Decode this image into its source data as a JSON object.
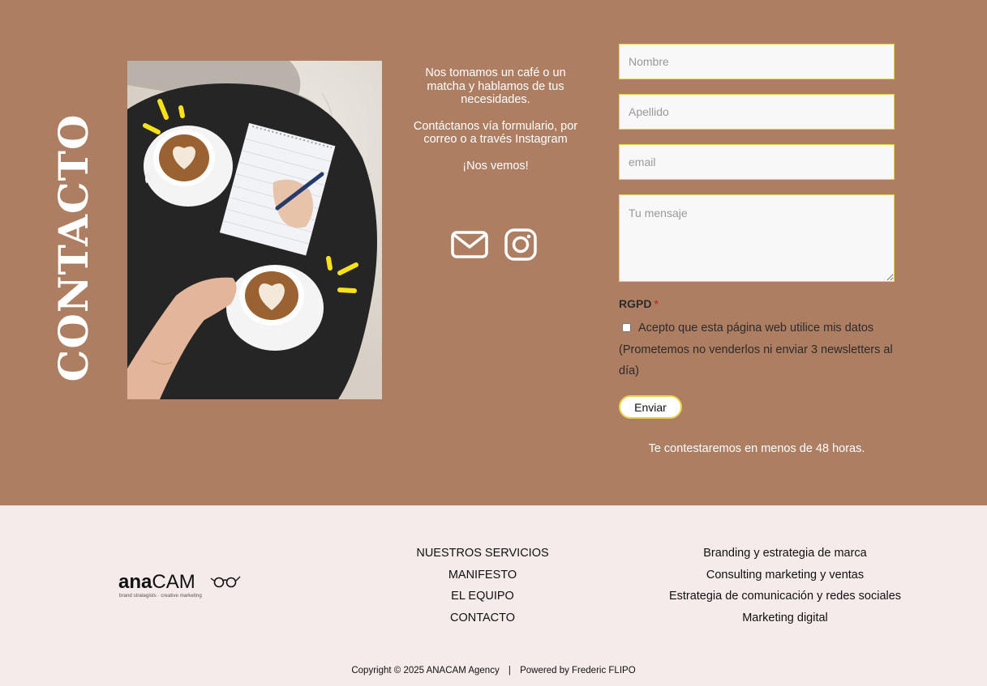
{
  "contact": {
    "title": "CONTACTO",
    "intro": [
      "Nos tomamos un café o un matcha y hablamos de tus necesidades.",
      "Contáctanos vía formulario, por correo o a través Instagram",
      "¡Nos vemos!"
    ],
    "icons": [
      "envelope-icon",
      "instagram-icon"
    ]
  },
  "form": {
    "first_name_placeholder": "Nombre",
    "last_name_placeholder": "Apellido",
    "email_placeholder": "email",
    "message_placeholder": "Tu mensaje",
    "rgpd_label": "RGPD",
    "required_mark": "*",
    "consent_text": "Acepto que esta página web utilice mis datos (Prometemos no venderlos ni enviar 3 newsletters al día)",
    "submit_label": "Enviar",
    "reply_note": "Te contestaremos en menos de 48 horas."
  },
  "footer": {
    "logo_text": "anaCAM",
    "logo_tagline": "brand strategists · creative marketing",
    "nav": [
      "NUESTROS SERVICIOS",
      "MANIFESTO",
      "EL EQUIPO",
      "CONTACTO"
    ],
    "services": [
      "Branding y estrategia de marca",
      "Consulting marketing y ventas",
      "Estrategia de comunicación y redes sociales",
      "Marketing digital"
    ],
    "copyright": "Copyright © 2025 ANACAM Agency",
    "separator": "|",
    "credit": "Powered by Frederic FLIPO"
  },
  "colors": {
    "section_bg": "#ae7e63",
    "footer_bg": "#f5ebea",
    "field_border": "#e8d34d",
    "accent_yellow": "#f7e21a"
  }
}
